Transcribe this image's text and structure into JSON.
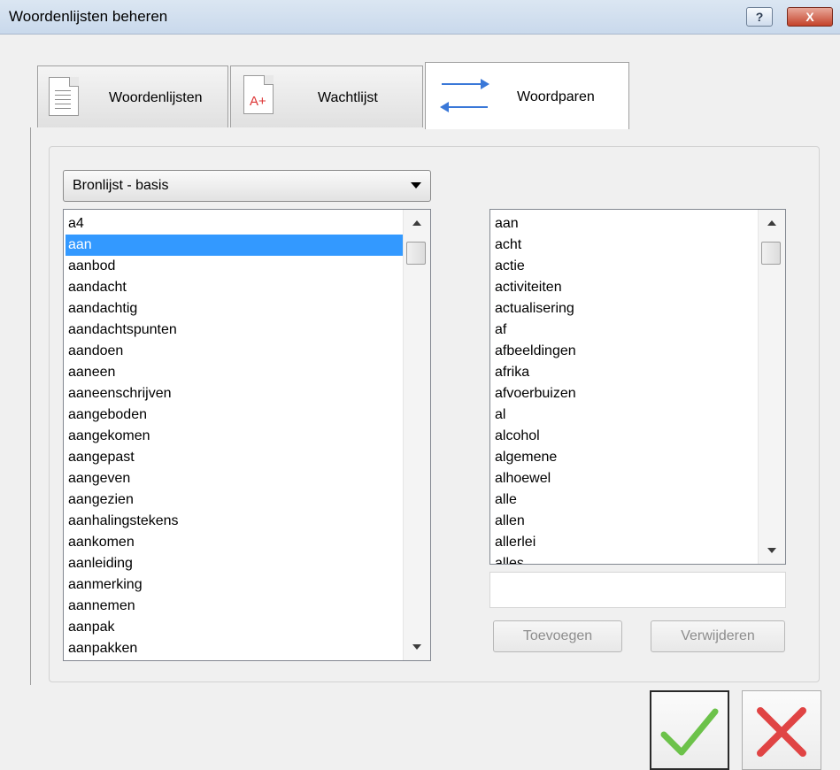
{
  "window": {
    "title": "Woordenlijsten beheren",
    "help_label": "?",
    "close_label": "X"
  },
  "tabs": [
    {
      "label": "Woordenlijsten",
      "icon": "document-icon"
    },
    {
      "label": "Wachtlijst",
      "icon": "document-aplus-icon"
    },
    {
      "label": "Woordparen",
      "icon": "swap-arrows-icon",
      "active": true
    }
  ],
  "source_dropdown": {
    "selected": "Bronlijst - basis"
  },
  "left_list": {
    "items": [
      "a4",
      "aan",
      "aanbod",
      "aandacht",
      "aandachtig",
      "aandachtspunten",
      "aandoen",
      "aaneen",
      "aaneenschrijven",
      "aangeboden",
      "aangekomen",
      "aangepast",
      "aangeven",
      "aangezien",
      "aanhalingstekens",
      "aankomen",
      "aanleiding",
      "aanmerking",
      "aannemen",
      "aanpak",
      "aanpakken"
    ],
    "selected_index": 1
  },
  "right_list": {
    "items": [
      "aan",
      "acht",
      "actie",
      "activiteiten",
      "actualisering",
      "af",
      "afbeeldingen",
      "afrika",
      "afvoerbuizen",
      "al",
      "alcohol",
      "algemene",
      "alhoewel",
      "alle",
      "allen",
      "allerlei",
      "alles"
    ]
  },
  "word_input": {
    "value": ""
  },
  "buttons": {
    "add_label": "Toevoegen",
    "remove_label": "Verwijderen"
  },
  "colors": {
    "selection": "#3399ff",
    "arrow_blue": "#3a78d8",
    "ok_green": "#6cc24a",
    "cancel_red": "#e04444"
  }
}
